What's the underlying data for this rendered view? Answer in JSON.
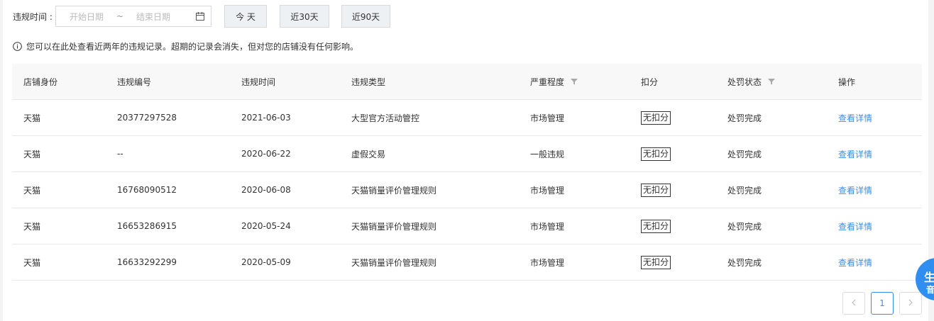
{
  "filter": {
    "label": "违规时间 :",
    "start_placeholder": "开始日期",
    "separator": "~",
    "end_placeholder": "结束日期",
    "quick_buttons": {
      "today": "今 天",
      "last30": "近30天",
      "last90": "近90天"
    }
  },
  "notice": "您可以在此处查看近两年的违规记录。超期的记录会消失，但对您的店铺没有任何影响。",
  "table": {
    "headers": [
      "店铺身份",
      "违规编号",
      "违规时间",
      "违规类型",
      "严重程度",
      "扣分",
      "处罚状态",
      "操作"
    ],
    "rows": [
      {
        "identity": "天猫",
        "id": "20377297528",
        "time": "2021-06-03",
        "type": "大型官方活动管控",
        "severity": "市场管理",
        "score": "无扣分",
        "status": "处罚完成",
        "action": "查看详情"
      },
      {
        "identity": "天猫",
        "id": "--",
        "time": "2020-06-22",
        "type": "虚假交易",
        "severity": "一般违规",
        "score": "无扣分",
        "status": "处罚完成",
        "action": "查看详情"
      },
      {
        "identity": "天猫",
        "id": "16768090512",
        "time": "2020-06-08",
        "type": "天猫销量评价管理规则",
        "severity": "市场管理",
        "score": "无扣分",
        "status": "处罚完成",
        "action": "查看详情"
      },
      {
        "identity": "天猫",
        "id": "16653286915",
        "time": "2020-05-24",
        "type": "天猫销量评价管理规则",
        "severity": "市场管理",
        "score": "无扣分",
        "status": "处罚完成",
        "action": "查看详情"
      },
      {
        "identity": "天猫",
        "id": "16633292299",
        "time": "2020-05-09",
        "type": "天猫销量评价管理规则",
        "severity": "市场管理",
        "score": "无扣分",
        "status": "处罚完成",
        "action": "查看详情"
      }
    ]
  },
  "pagination": {
    "prev": "<",
    "current": "1",
    "next": ">"
  },
  "float_badge": {
    "line1": "生",
    "line2": "音"
  },
  "colors": {
    "link": "#3a8ee6",
    "header_bg": "#f8f8f8",
    "button_bg": "#eef1f4",
    "badge": "#2f8ef0"
  }
}
